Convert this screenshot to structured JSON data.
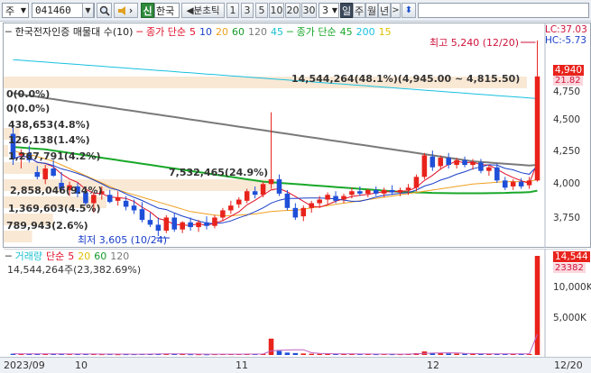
{
  "toolbar": {
    "market_label": "주",
    "stock_code": "041460",
    "new_label": "신",
    "stock_name": "한국",
    "period_label": "◀분초틱",
    "intervals": [
      "1",
      "3",
      "5",
      "10",
      "20",
      "30"
    ],
    "custom_interval": "3",
    "period_buttons": [
      "일",
      "주",
      "월",
      "년"
    ],
    "selected_period": "일"
  },
  "price_panel": {
    "legend_title": "한국전자인증 매물대 수(10)",
    "ma_label": "종가 단순",
    "ma_periods": [
      "5",
      "10",
      "20",
      "60",
      "120",
      "45"
    ],
    "ma_colors": [
      "#e0102a",
      "#1a3fc8",
      "#f0a020",
      "#159a2a",
      "#7a7a7a",
      "#1cc0d0"
    ],
    "ma2_label": "종가 단순",
    "ma2_periods": [
      "45",
      "200",
      "15"
    ],
    "ma2_colors": [
      "#19a82a",
      "#18c0e0",
      "#e0c000"
    ],
    "lc_label": "LC:37.03",
    "hc_label": "HC:-5.73",
    "high_annotation": "최고 5,240 (12/20)",
    "low_annotation": "최저 3,605 (10/24)",
    "current_price": "4,940",
    "current_change": "21.82",
    "axis_ticks": [
      "4,750",
      "4,500",
      "4,250",
      "4,000",
      "3,750"
    ],
    "profile_labels": [
      "14,544,264(48.1%)(4,945.00 ~ 4,815.50)",
      "0(0.0%)",
      "0(0.0%)",
      "438,653(4.8%)",
      "126,138(1.4%)",
      "1,267,791(4.2%)",
      "7,532,465(24.9%)",
      "2,858,046(9.4%)",
      "1,369,603(4.5%)",
      "789,943(2.6%)"
    ],
    "profile_values": [
      14544264,
      0,
      0,
      438653,
      126138,
      1267791,
      7532465,
      2858046,
      1369603,
      789943
    ]
  },
  "volume_panel": {
    "legend_label": "거래량",
    "ma_label": "단순",
    "ma_periods": [
      "5",
      "20",
      "60",
      "120"
    ],
    "ma_colors": [
      "#e0102a",
      "#e0c000",
      "#159a2a",
      "#7a7a7a"
    ],
    "summary": "14,544,264주(23,382.69%)",
    "current_volume": "14,544",
    "current_ratio": "23382",
    "axis_ticks": [
      "10,000K",
      "5,000K"
    ]
  },
  "x_axis": {
    "labels": [
      "2023/09",
      "10",
      "11",
      "12",
      "12/20"
    ]
  },
  "chart_data": {
    "type": "candlestick",
    "price_ylim": [
      3575,
      5240
    ],
    "volume_ylim": [
      0,
      14544
    ],
    "candles": [
      {
        "o": 4460,
        "h": 4530,
        "l": 4200,
        "c": 4250,
        "v": 180
      },
      {
        "o": 4280,
        "h": 4330,
        "l": 4170,
        "c": 4300,
        "v": 160
      },
      {
        "o": 4300,
        "h": 4360,
        "l": 4220,
        "c": 4240,
        "v": 150
      },
      {
        "o": 4140,
        "h": 4190,
        "l": 4080,
        "c": 4100,
        "v": 140
      },
      {
        "o": 4080,
        "h": 4200,
        "l": 4040,
        "c": 4170,
        "v": 170
      },
      {
        "o": 4170,
        "h": 4240,
        "l": 4100,
        "c": 4110,
        "v": 160
      },
      {
        "o": 4050,
        "h": 4140,
        "l": 3980,
        "c": 4000,
        "v": 150
      },
      {
        "o": 3990,
        "h": 4060,
        "l": 3940,
        "c": 4030,
        "v": 140
      },
      {
        "o": 4020,
        "h": 4050,
        "l": 3930,
        "c": 3960,
        "v": 130
      },
      {
        "o": 3970,
        "h": 4000,
        "l": 3860,
        "c": 3880,
        "v": 140
      },
      {
        "o": 3880,
        "h": 3960,
        "l": 3800,
        "c": 3950,
        "v": 150
      },
      {
        "o": 3960,
        "h": 4020,
        "l": 3910,
        "c": 3980,
        "v": 120
      },
      {
        "o": 3950,
        "h": 3990,
        "l": 3880,
        "c": 3890,
        "v": 130
      },
      {
        "o": 3900,
        "h": 3980,
        "l": 3860,
        "c": 3930,
        "v": 110
      },
      {
        "o": 3900,
        "h": 3940,
        "l": 3820,
        "c": 3850,
        "v": 120
      },
      {
        "o": 3860,
        "h": 3910,
        "l": 3790,
        "c": 3820,
        "v": 120
      },
      {
        "o": 3830,
        "h": 3890,
        "l": 3720,
        "c": 3740,
        "v": 140
      },
      {
        "o": 3740,
        "h": 3800,
        "l": 3680,
        "c": 3700,
        "v": 150
      },
      {
        "o": 3700,
        "h": 3760,
        "l": 3605,
        "c": 3650,
        "v": 200
      },
      {
        "o": 3650,
        "h": 3780,
        "l": 3630,
        "c": 3760,
        "v": 180
      },
      {
        "o": 3760,
        "h": 3800,
        "l": 3640,
        "c": 3660,
        "v": 140
      },
      {
        "o": 3660,
        "h": 3730,
        "l": 3630,
        "c": 3720,
        "v": 130
      },
      {
        "o": 3720,
        "h": 3760,
        "l": 3650,
        "c": 3680,
        "v": 110
      },
      {
        "o": 3680,
        "h": 3740,
        "l": 3640,
        "c": 3720,
        "v": 110
      },
      {
        "o": 3720,
        "h": 3770,
        "l": 3660,
        "c": 3690,
        "v": 100
      },
      {
        "o": 3690,
        "h": 3780,
        "l": 3670,
        "c": 3760,
        "v": 120
      },
      {
        "o": 3760,
        "h": 3840,
        "l": 3730,
        "c": 3820,
        "v": 130
      },
      {
        "o": 3820,
        "h": 3900,
        "l": 3790,
        "c": 3860,
        "v": 140
      },
      {
        "o": 3870,
        "h": 3930,
        "l": 3840,
        "c": 3910,
        "v": 130
      },
      {
        "o": 3900,
        "h": 4000,
        "l": 3880,
        "c": 3980,
        "v": 150
      },
      {
        "o": 3980,
        "h": 4020,
        "l": 3920,
        "c": 3950,
        "v": 130
      },
      {
        "o": 3950,
        "h": 4060,
        "l": 3930,
        "c": 4040,
        "v": 180
      },
      {
        "o": 4040,
        "h": 4640,
        "l": 4000,
        "c": 4080,
        "v": 2400
      },
      {
        "o": 4080,
        "h": 4120,
        "l": 3940,
        "c": 3960,
        "v": 600
      },
      {
        "o": 3960,
        "h": 3990,
        "l": 3820,
        "c": 3840,
        "v": 350
      },
      {
        "o": 3840,
        "h": 3880,
        "l": 3740,
        "c": 3760,
        "v": 280
      },
      {
        "o": 3770,
        "h": 3860,
        "l": 3730,
        "c": 3840,
        "v": 220
      },
      {
        "o": 3840,
        "h": 3900,
        "l": 3800,
        "c": 3880,
        "v": 180
      },
      {
        "o": 3880,
        "h": 3940,
        "l": 3840,
        "c": 3910,
        "v": 160
      },
      {
        "o": 3910,
        "h": 3970,
        "l": 3870,
        "c": 3950,
        "v": 170
      },
      {
        "o": 3940,
        "h": 3980,
        "l": 3880,
        "c": 3900,
        "v": 150
      },
      {
        "o": 3910,
        "h": 3960,
        "l": 3880,
        "c": 3940,
        "v": 150
      },
      {
        "o": 3950,
        "h": 4010,
        "l": 3920,
        "c": 3980,
        "v": 140
      },
      {
        "o": 3980,
        "h": 4020,
        "l": 3940,
        "c": 3960,
        "v": 130
      },
      {
        "o": 3960,
        "h": 4000,
        "l": 3930,
        "c": 3990,
        "v": 130
      },
      {
        "o": 3990,
        "h": 4020,
        "l": 3940,
        "c": 3960,
        "v": 120
      },
      {
        "o": 3960,
        "h": 4010,
        "l": 3930,
        "c": 3990,
        "v": 130
      },
      {
        "o": 3990,
        "h": 4030,
        "l": 3950,
        "c": 3970,
        "v": 120
      },
      {
        "o": 3970,
        "h": 4010,
        "l": 3940,
        "c": 3990,
        "v": 120
      },
      {
        "o": 3990,
        "h": 4040,
        "l": 3950,
        "c": 4010,
        "v": 140
      },
      {
        "o": 4010,
        "h": 4120,
        "l": 3980,
        "c": 4100,
        "v": 260
      },
      {
        "o": 4100,
        "h": 4300,
        "l": 4080,
        "c": 4280,
        "v": 520
      },
      {
        "o": 4270,
        "h": 4320,
        "l": 4150,
        "c": 4180,
        "v": 320
      },
      {
        "o": 4190,
        "h": 4280,
        "l": 4160,
        "c": 4260,
        "v": 260
      },
      {
        "o": 4260,
        "h": 4300,
        "l": 4170,
        "c": 4200,
        "v": 220
      },
      {
        "o": 4200,
        "h": 4260,
        "l": 4170,
        "c": 4240,
        "v": 200
      },
      {
        "o": 4240,
        "h": 4270,
        "l": 4180,
        "c": 4200,
        "v": 180
      },
      {
        "o": 4200,
        "h": 4250,
        "l": 4160,
        "c": 4220,
        "v": 170
      },
      {
        "o": 4220,
        "h": 4250,
        "l": 4130,
        "c": 4150,
        "v": 170
      },
      {
        "o": 4150,
        "h": 4200,
        "l": 4110,
        "c": 4180,
        "v": 160
      },
      {
        "o": 4180,
        "h": 4210,
        "l": 4050,
        "c": 4070,
        "v": 180
      },
      {
        "o": 4070,
        "h": 4100,
        "l": 3990,
        "c": 4010,
        "v": 160
      },
      {
        "o": 4020,
        "h": 4080,
        "l": 3990,
        "c": 4060,
        "v": 150
      },
      {
        "o": 4060,
        "h": 4090,
        "l": 4000,
        "c": 4020,
        "v": 140
      },
      {
        "o": 4030,
        "h": 4100,
        "l": 4000,
        "c": 4070,
        "v": 150
      },
      {
        "o": 4070,
        "h": 5240,
        "l": 4060,
        "c": 4940,
        "v": 14544
      }
    ],
    "ma20": [
      4320,
      4300,
      4290,
      4270,
      4250,
      4230,
      4200,
      4170,
      4140,
      4110,
      4080,
      4050,
      4020,
      3990,
      3970,
      3950,
      3930,
      3910,
      3890,
      3870,
      3850,
      3830,
      3810,
      3800,
      3790,
      3780,
      3775,
      3775,
      3780,
      3785,
      3790,
      3800,
      3810,
      3815,
      3820,
      3820,
      3830,
      3840,
      3850,
      3860,
      3870,
      3880,
      3890,
      3900,
      3910,
      3920,
      3930,
      3940,
      3950,
      3960,
      3970,
      3980,
      3990,
      4000,
      4010,
      4020,
      4030,
      4040,
      4045,
      4050,
      4055,
      4060,
      4060,
      4060,
      4060,
      4080
    ],
    "ma60": [
      4350,
      4345,
      4340,
      4335,
      4330,
      4320,
      4310,
      4300,
      4290,
      4280,
      4270,
      4260,
      4250,
      4240,
      4230,
      4220,
      4210,
      4200,
      4190,
      4180,
      4170,
      4160,
      4150,
      4140,
      4130,
      4120,
      4110,
      4100,
      4090,
      4080,
      4070,
      4060,
      4055,
      4050,
      4045,
      4040,
      4035,
      4030,
      4025,
      4020,
      4015,
      4010,
      4005,
      4000,
      3995,
      3990,
      3985,
      3980,
      3975,
      3972,
      3970,
      3968,
      3966,
      3965,
      3964,
      3963,
      3963,
      3963,
      3963,
      3964,
      3965,
      3966,
      3968,
      3970,
      3972,
      3985
    ],
    "ma120": [
      4800,
      4790,
      4780,
      4770,
      4760,
      4750,
      4740,
      4730,
      4720,
      4710,
      4700,
      4690,
      4680,
      4670,
      4660,
      4650,
      4640,
      4630,
      4620,
      4610,
      4600,
      4590,
      4580,
      4570,
      4560,
      4550,
      4540,
      4530,
      4520,
      4510,
      4500,
      4490,
      4480,
      4470,
      4460,
      4450,
      4440,
      4430,
      4420,
      4410,
      4400,
      4390,
      4380,
      4370,
      4360,
      4350,
      4340,
      4330,
      4320,
      4310,
      4300,
      4290,
      4280,
      4270,
      4260,
      4250,
      4240,
      4230,
      4225,
      4220,
      4215,
      4210,
      4205,
      4200,
      4195,
      4200
    ],
    "ma200": [
      5080,
      5075,
      5070,
      5065,
      5060,
      5055,
      5050,
      5045,
      5040,
      5035,
      5030,
      5025,
      5020,
      5015,
      5010,
      5005,
      5000,
      4995,
      4990,
      4985,
      4980,
      4975,
      4970,
      4965,
      4960,
      4955,
      4950,
      4945,
      4940,
      4935,
      4930,
      4925,
      4920,
      4915,
      4910,
      4905,
      4900,
      4895,
      4890,
      4885,
      4880,
      4875,
      4870,
      4865,
      4860,
      4855,
      4850,
      4845,
      4840,
      4835,
      4830,
      4825,
      4820,
      4815,
      4810,
      4805,
      4800,
      4795,
      4790,
      4785,
      4780,
      4775,
      4770,
      4765,
      4760,
      4755
    ]
  }
}
